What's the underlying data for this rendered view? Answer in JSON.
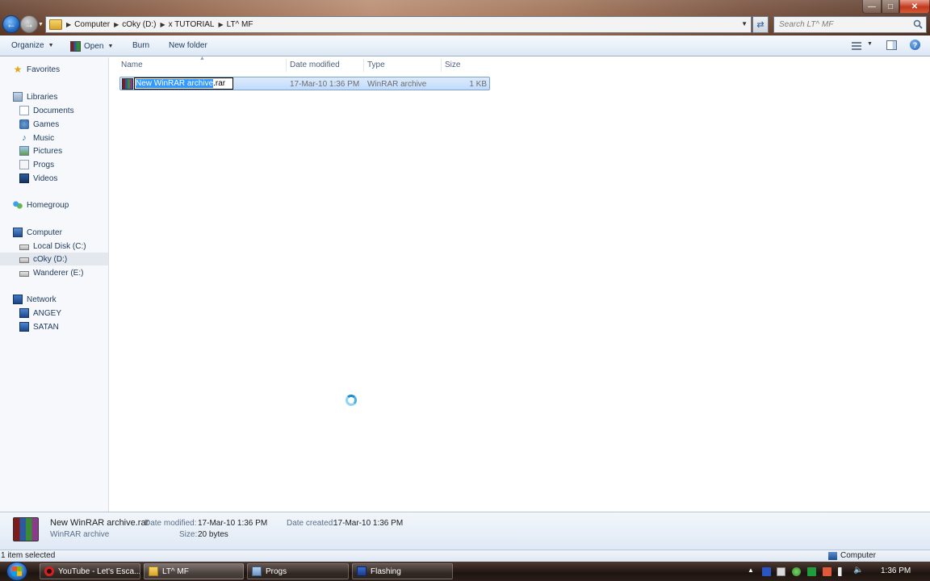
{
  "window": {
    "breadcrumbs": [
      "Computer",
      "cOky (D:)",
      "x TUTORIAL",
      "LT^ MF"
    ],
    "search_placeholder": "Search LT^ MF",
    "minimize": "—",
    "maximize": "□",
    "close": "✕"
  },
  "toolbar": {
    "organize": "Organize",
    "open": "Open",
    "burn": "Burn",
    "new_folder": "New folder"
  },
  "navpane": {
    "favorites": "Favorites",
    "libraries": "Libraries",
    "documents": "Documents",
    "games": "Games",
    "music": "Music",
    "pictures": "Pictures",
    "progs": "Progs",
    "videos": "Videos",
    "homegroup": "Homegroup",
    "computer": "Computer",
    "local_disk": "Local Disk (C:)",
    "coky": "cOky (D:)",
    "wanderer": "Wanderer (E:)",
    "network": "Network",
    "angey": "ANGEY",
    "satan": "SATAN"
  },
  "columns": {
    "name": "Name",
    "date_modified": "Date modified",
    "type": "Type",
    "size": "Size"
  },
  "file": {
    "rename_selected": "New WinRAR archive",
    "rename_rest": ".rar",
    "date_modified": "17-Mar-10 1:36 PM",
    "type": "WinRAR archive",
    "size": "1 KB"
  },
  "details": {
    "name": "New WinRAR archive.rar",
    "type": "WinRAR archive",
    "date_modified_label": "Date modified:",
    "date_modified": "17-Mar-10 1:36 PM",
    "size_label": "Size:",
    "size": "20 bytes",
    "date_created_label": "Date created:",
    "date_created": "17-Mar-10 1:36 PM"
  },
  "status": {
    "selection": "1 item selected",
    "location": "Computer"
  },
  "taskbar": {
    "tasks": [
      "YouTube - Let's Esca...",
      "LT^ MF",
      "Progs",
      "Flashing"
    ],
    "clock": "1:36 PM"
  }
}
